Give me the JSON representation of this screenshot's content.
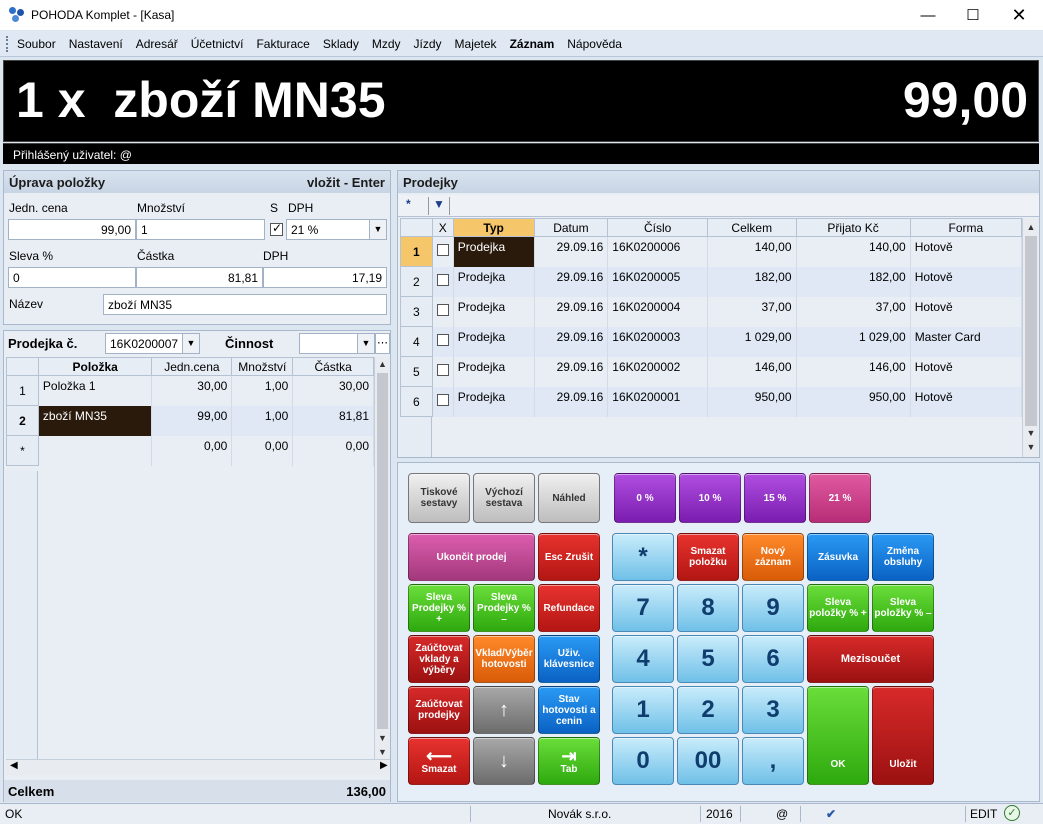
{
  "window": {
    "title": "POHODA Komplet - [Kasa]"
  },
  "menu": [
    "Soubor",
    "Nastavení",
    "Adresář",
    "Účetnictví",
    "Fakturace",
    "Sklady",
    "Mzdy",
    "Jízdy",
    "Majetek",
    "Záznam",
    "Nápověda"
  ],
  "display": {
    "left": "1 x  zboží MN35",
    "right": "99,00",
    "user": "Přihlášený uživatel: @"
  },
  "edit": {
    "title": "Úprava položky",
    "hint": "vložit - Enter",
    "lbl_price": "Jedn. cena",
    "lbl_qty": "Množství",
    "lbl_s": "S",
    "lbl_vat": "DPH",
    "price": "99,00",
    "qty": "1",
    "vat_rate": "21 %",
    "lbl_disc": "Sleva %",
    "lbl_amount": "Částka",
    "lbl_vat2": "DPH",
    "disc": "0",
    "amount": "81,81",
    "vat": "17,19",
    "lbl_name": "Název",
    "name": "zboží MN35"
  },
  "receipt": {
    "lbl_no": "Prodejka č.",
    "no": "16K0200007",
    "lbl_activity": "Činnost",
    "activity": "",
    "cols": [
      "Položka",
      "Jedn.cena",
      "Množství",
      "Částka"
    ],
    "rows": [
      {
        "n": "1",
        "item": "Položka 1",
        "price": "30,00",
        "qty": "1,00",
        "amount": "30,00"
      },
      {
        "n": "2",
        "item": "zboží MN35",
        "price": "99,00",
        "qty": "1,00",
        "amount": "81,81"
      },
      {
        "n": "*",
        "item": "",
        "price": "0,00",
        "qty": "0,00",
        "amount": "0,00"
      }
    ],
    "total_label": "Celkem",
    "total": "136,00"
  },
  "sales": {
    "title": "Prodejky",
    "cols": [
      "X",
      "Typ",
      "Datum",
      "Číslo",
      "Celkem",
      "Přijato Kč",
      "Forma"
    ],
    "rows": [
      {
        "n": "1",
        "type": "Prodejka",
        "date": "29.09.16",
        "no": "16K0200006",
        "total": "140,00",
        "paid": "140,00",
        "form": "Hotově"
      },
      {
        "n": "2",
        "type": "Prodejka",
        "date": "29.09.16",
        "no": "16K0200005",
        "total": "182,00",
        "paid": "182,00",
        "form": "Hotově"
      },
      {
        "n": "3",
        "type": "Prodejka",
        "date": "29.09.16",
        "no": "16K0200004",
        "total": "37,00",
        "paid": "37,00",
        "form": "Hotově"
      },
      {
        "n": "4",
        "type": "Prodejka",
        "date": "29.09.16",
        "no": "16K0200003",
        "total": "1 029,00",
        "paid": "1 029,00",
        "form": "Master Card"
      },
      {
        "n": "5",
        "type": "Prodejka",
        "date": "29.09.16",
        "no": "16K0200002",
        "total": "146,00",
        "paid": "146,00",
        "form": "Hotově"
      },
      {
        "n": "6",
        "type": "Prodejka",
        "date": "29.09.16",
        "no": "16K0200001",
        "total": "950,00",
        "paid": "950,00",
        "form": "Hotově"
      }
    ]
  },
  "buttons": {
    "tisk": "Tiskové sestavy",
    "vychozi": "Výchozí sestava",
    "nahled": "Náhled",
    "p0": "0 %",
    "p10": "10 %",
    "p15": "15 %",
    "p21": "21 %",
    "ukoncit": "Ukončit prodej",
    "esc": "Esc Zrušit",
    "smazat_pol": "Smazat položku",
    "novy": "Nový záznam",
    "zasuvka": "Zásuvka",
    "zmena": "Změna obsluhy",
    "sleva_p_plus": "Sleva Prodejky % +",
    "sleva_p_minus": "Sleva Prodejky % –",
    "refundace": "Refundace",
    "sleva_pol_plus": "Sleva položky % +",
    "sleva_pol_minus": "Sleva položky % –",
    "zauct_vklady": "Zaúčtovat vklady a výběry",
    "vklad": "Vklad/Výběr hotovosti",
    "uziv": "Uživ. klávesnice",
    "mezisoucet": "Mezisoučet",
    "zauct_prodejky": "Zaúčtovat prodejky",
    "stav": "Stav hotovosti a cenin",
    "ok": "OK",
    "ulozit": "Uložit",
    "smazat": "Smazat",
    "tab": "Tab",
    "star": "*",
    "n7": "7",
    "n8": "8",
    "n9": "9",
    "n4": "4",
    "n5": "5",
    "n6": "6",
    "n1": "1",
    "n2": "2",
    "n3": "3",
    "n0": "0",
    "n00": "00",
    "comma": ","
  },
  "status": {
    "left": "OK",
    "company": "Novák s.r.o.",
    "year": "2016",
    "at": "@",
    "mode": "EDIT"
  }
}
